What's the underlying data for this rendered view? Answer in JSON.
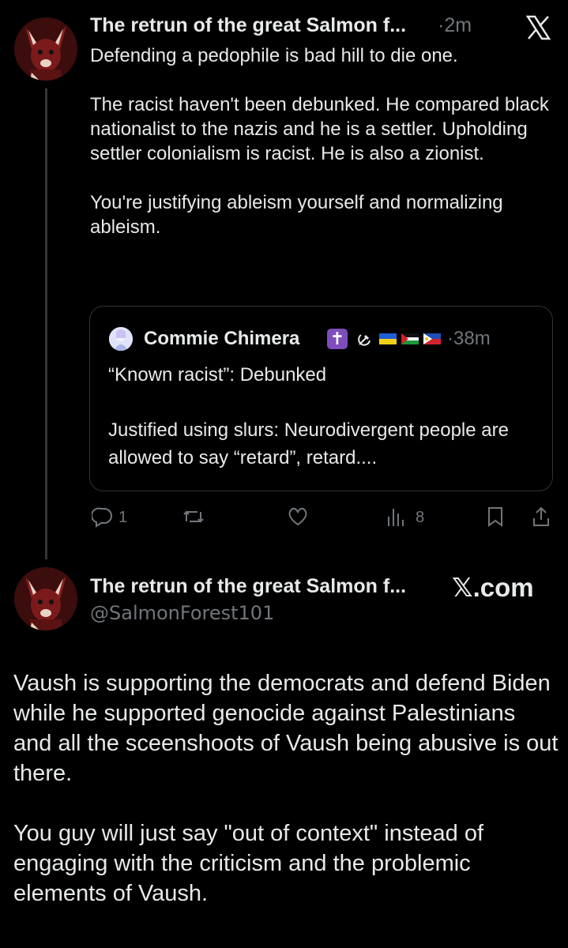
{
  "tweet": {
    "author_name": "The retrun of the great Salmon f...",
    "time": "·2m",
    "text": "Defending a pedophile is bad hill to die one.\n\nThe racist haven't been debunked.  He compared black nationalist to the nazis and he is a settler.  Upholding settler colonialism is racist. He is also a zionist.\n\nYou're justifying ableism yourself and normalizing ableism.",
    "quote": {
      "author_name": "Commie Chimera",
      "badge": "✝",
      "time": "·38m",
      "text": "“Known racist”: Debunked\n\nJustified using slurs: Neurodivergent people are allowed to say “retard”, retard...."
    },
    "actions": {
      "replies": "1",
      "views": "8"
    }
  },
  "card": {
    "author_name": "The retrun of the great Salmon f...",
    "handle": "@SalmonForest101",
    "source": "𝕏.com",
    "text": "Vaush is supporting the democrats and defend Biden while he supported genocide against Palestinians and all the sceenshoots of Vaush being abusive is out there.\n\nYou guy will just say \"out of context\" instead of engaging with the criticism and the problemic elements of Vaush."
  },
  "colors": {
    "background": "#000000",
    "text": "#e7e9ea",
    "muted": "#71767b",
    "border": "#2f3336"
  }
}
